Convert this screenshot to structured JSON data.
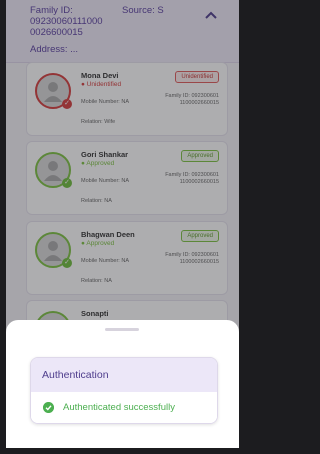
{
  "header": {
    "family_id_label": "Family ID:",
    "family_id_value": "09230060111000 0026600015",
    "source_label": "Source: S",
    "address_label": "Address: ..."
  },
  "members": [
    {
      "name": "Mona Devi",
      "status": "Unidentified",
      "badge": "Unidentified",
      "mobile": "Mobile Number: NA",
      "family_id": "Family ID: 092300601 1100002660015",
      "relation": "Relation: Wife"
    },
    {
      "name": "Gori Shankar",
      "status": "Approved",
      "badge": "Approved",
      "mobile": "Mobile Number: NA",
      "family_id": "Family ID: 092300601 1100002660015",
      "relation": "Relation: NA"
    },
    {
      "name": "Bhagwan Deen",
      "status": "Approved",
      "badge": "Approved",
      "mobile": "Mobile Number: NA",
      "family_id": "Family ID: 092300601 1100002660015",
      "relation": "Relation: NA"
    },
    {
      "name": "Sonapti"
    }
  ],
  "dialog": {
    "title": "Authentication",
    "message": "Authenticated successfully"
  },
  "colors": {
    "accent": "#5a3fa0",
    "success": "#4caf50",
    "error": "#d63c3c"
  }
}
